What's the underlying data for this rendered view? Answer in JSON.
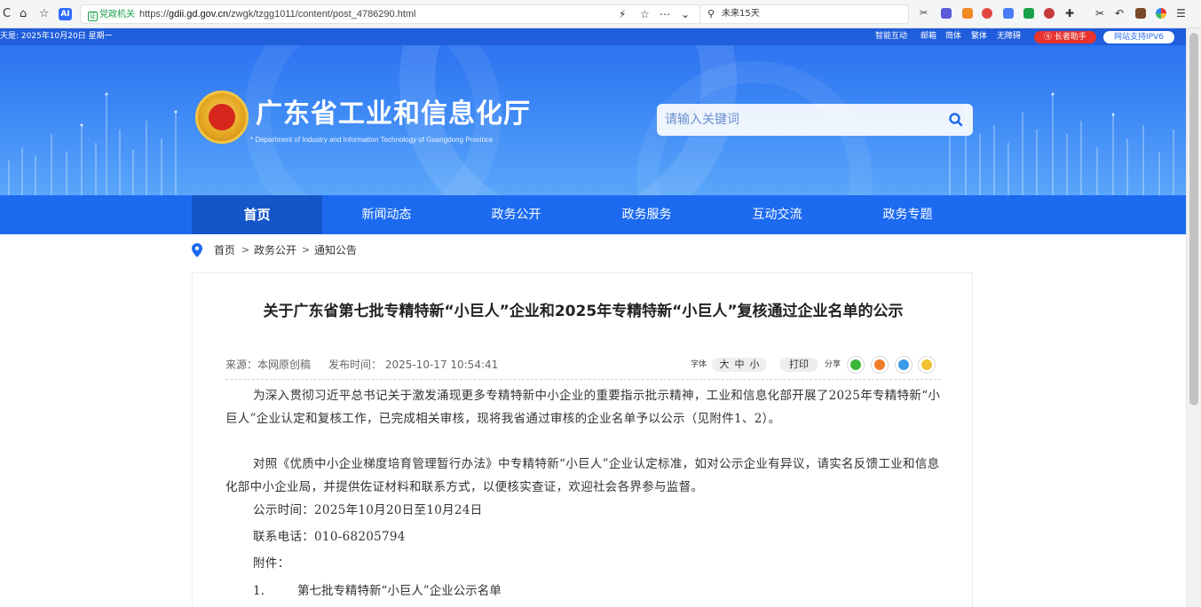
{
  "browser": {
    "url_badge": "党政机关",
    "url_prefix": "https://",
    "url_domain": "gdii.gd.gov.cn",
    "url_path": "/zwgk/tzgg1011/content/post_4786290.html",
    "search_text": "未来15天",
    "ai_label": "AI"
  },
  "site": {
    "date_text": "天是: 2025年10月20日 星期一",
    "util_links": [
      "智能互动",
      "邮箱",
      "简体",
      "繁体",
      "无障碍"
    ],
    "elder_label": "长者助手",
    "ipv6_label": "网站支持IPV6",
    "title": "广东省工业和信息化厅",
    "subtitle": "Department of Industry and Information Technology of Guangdong Province",
    "search_placeholder": "请输入关键词"
  },
  "nav": {
    "items": [
      "首页",
      "新闻动态",
      "政务公开",
      "政务服务",
      "互动交流",
      "政务专题"
    ],
    "active_index": 0
  },
  "breadcrumb": {
    "items": [
      "首页",
      "政务公开",
      "通知公告"
    ],
    "separator": ">"
  },
  "article": {
    "title": "关于广东省第七批专精特新“小巨人”企业和2025年专精特新“小巨人”复核通过企业名单的公示",
    "source": "来源：本网原创稿",
    "publish_time": "发布时间： 2025-10-17 10:54:41",
    "font_label": "字体",
    "font_sizes": [
      "大",
      "中",
      "小"
    ],
    "print_label": "打印",
    "share_label": "分享",
    "paragraphs": [
      "为深入贯彻习近平总书记关于激发涌现更多专精特新中小企业的重要指示批示精神，工业和信息化部开展了2025年专精特新“小巨人”企业认定和复核工作，已完成相关审核，现将我省通过审核的企业名单予以公示（见附件1、2）。",
      "对照《优质中小企业梯度培育管理暂行办法》中专精特新“小巨人”企业认定标准，如对公示企业有异议，请实名反馈工业和信息化部中小企业局，并提供佐证材料和联系方式，以便核实查证，欢迎社会各界参与监督。",
      "公示时间：2025年10月20日至10月24日",
      "联系电话：010-68205794",
      "附件："
    ],
    "attachments": [
      {
        "num": "1.",
        "label": "第七批专精特新“小巨人”企业公示名单"
      }
    ]
  },
  "colors": {
    "nav_bg": "#1c6af0",
    "nav_active": "#1456c9",
    "banner_top": "#2a6df0",
    "elder_red": "#e8332f"
  }
}
